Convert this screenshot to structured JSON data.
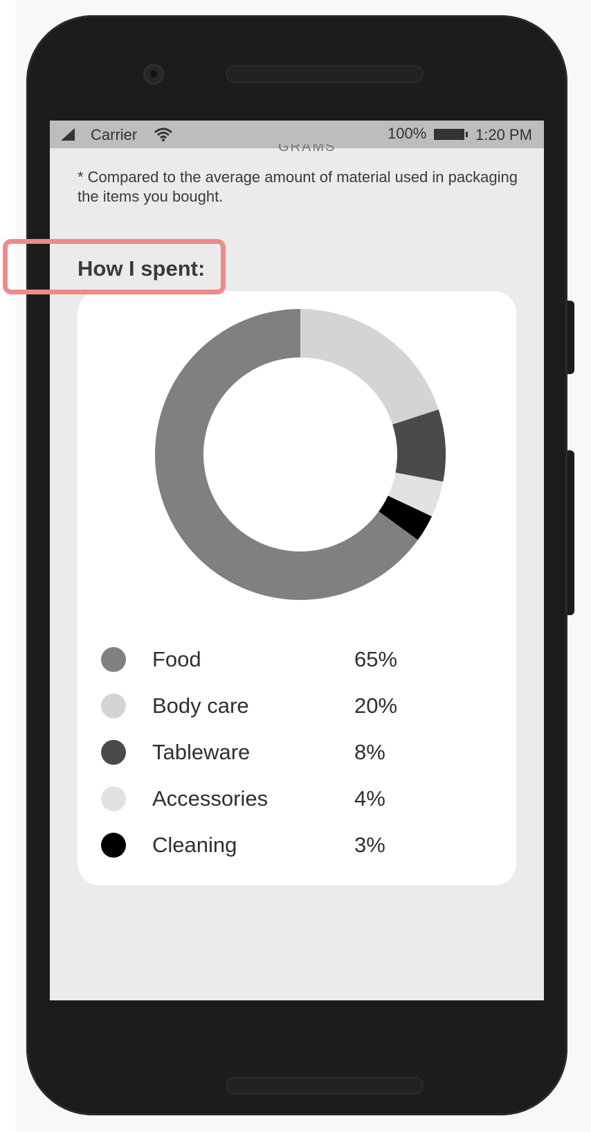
{
  "status_bar": {
    "carrier": "Carrier",
    "battery": "100%",
    "time": "1:20 PM"
  },
  "previous_section_cut": "GRAMS",
  "note": "* Compared to the average amount of material used in packaging the items you bought.",
  "section_title": "How I spent:",
  "colors": {
    "highlight": "#ef8a8a"
  },
  "chart_data": {
    "type": "pie",
    "title": "",
    "slices": [
      {
        "label": "Food",
        "value": 65,
        "display": "65%",
        "color": "#808080"
      },
      {
        "label": "Body care",
        "value": 20,
        "display": "20%",
        "color": "#d4d4d4"
      },
      {
        "label": "Tableware",
        "value": 8,
        "display": "8%",
        "color": "#4a4a4a"
      },
      {
        "label": "Accessories",
        "value": 4,
        "display": "4%",
        "color": "#e2e2e2"
      },
      {
        "label": "Cleaning",
        "value": 3,
        "display": "3%",
        "color": "#000000"
      }
    ]
  }
}
